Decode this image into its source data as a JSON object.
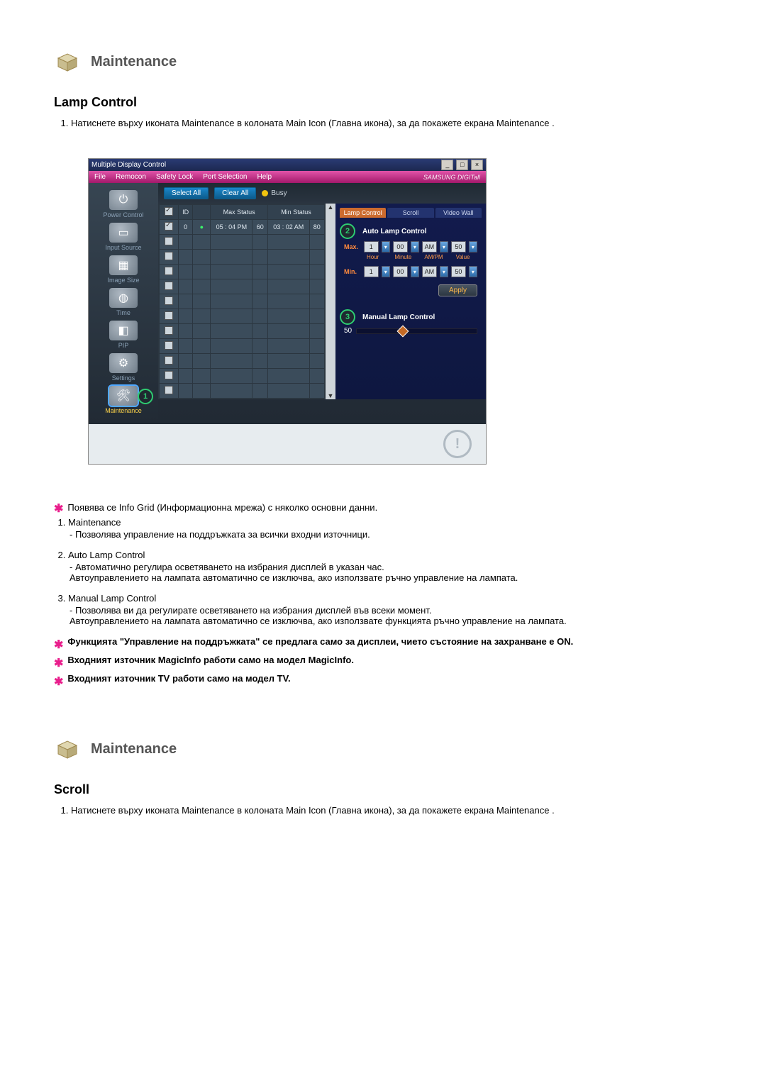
{
  "section1": {
    "heading": "Maintenance",
    "subtitle": "Lamp Control",
    "intro_item": "Натиснете върху иконата Maintenance в колоната Main Icon (Главна икона), за да покажете екрана Maintenance ."
  },
  "app": {
    "title": "Multiple Display Control",
    "win_min": "_",
    "win_max": "□",
    "win_close": "×",
    "menu": {
      "file": "File",
      "remocon": "Remocon",
      "safety": "Safety Lock",
      "port": "Port Selection",
      "help": "Help"
    },
    "brand": "SAMSUNG DIGITall",
    "toolbar": {
      "select_all": "Select All",
      "clear_all": "Clear All",
      "busy": "Busy"
    },
    "nav": {
      "power": "Power Control",
      "input": "Input Source",
      "image": "Image Size",
      "time": "Time",
      "pip": "PIP",
      "settings": "Settings",
      "maintenance": "Maintenance"
    },
    "table": {
      "h_id": "ID",
      "h_max": "Max Status",
      "h_min": "Min Status",
      "rows": [
        {
          "chk": true,
          "id": "0",
          "s": "●",
          "mt": "05 : 04 PM",
          "mv": "60",
          "nt": "03 : 02 AM",
          "nv": "80"
        },
        {
          "chk": false
        },
        {
          "chk": false
        },
        {
          "chk": false
        },
        {
          "chk": false
        },
        {
          "chk": false
        },
        {
          "chk": false
        },
        {
          "chk": false
        },
        {
          "chk": false
        },
        {
          "chk": false
        },
        {
          "chk": false
        },
        {
          "chk": false
        }
      ]
    },
    "right": {
      "tab_lamp": "Lamp Control",
      "tab_scroll": "Scroll",
      "tab_wall": "Video Wall",
      "auto_title": "Auto Lamp Control",
      "max": "Max.",
      "min": "Min.",
      "hour": "Hour",
      "minute": "Minute",
      "ampm": "AM/PM",
      "value": "Value",
      "h": "1",
      "m": "00",
      "ap": "AM",
      "v": "50",
      "apply": "Apply",
      "manual_title": "Manual Lamp Control",
      "manual_value": "50"
    },
    "badge1": "1",
    "badge2": "2",
    "badge3": "3",
    "info": "!"
  },
  "notes": {
    "intro": "Появява се Info Grid (Информационна мрежа) с няколко основни данни.",
    "i1_h": "Maintenance",
    "i1_t": "- Позволява управление на поддръжката за всички входни източници.",
    "i2_h": "Auto Lamp Control",
    "i2_t": "- Автоматично регулира осветяването на избрания дисплей в указан час.\nАвтоуправлението на лампата автоматично се изключва, ако използвате ръчно управление на лампата.",
    "i3_h": "Manual Lamp Control",
    "i3_t": "- Позволява ви да регулирате осветяването на избрания дисплей във всеки момент.\nАвтоуправлението на лампата автоматично се изключва, ако използвате функцията ръчно управление на лампата.",
    "b1": "Функцията \"Управление на поддръжката\" се предлага само за дисплеи, чието състояние на захранване е ON.",
    "b2": "Входният източник MagicInfo работи само на модел MagicInfo.",
    "b3": "Входният източник TV работи само на модел TV."
  },
  "section2": {
    "heading": "Maintenance",
    "subtitle": "Scroll",
    "intro_item": "Натиснете върху иконата Maintenance в колоната Main Icon (Главна икона), за да покажете екрана Maintenance ."
  }
}
